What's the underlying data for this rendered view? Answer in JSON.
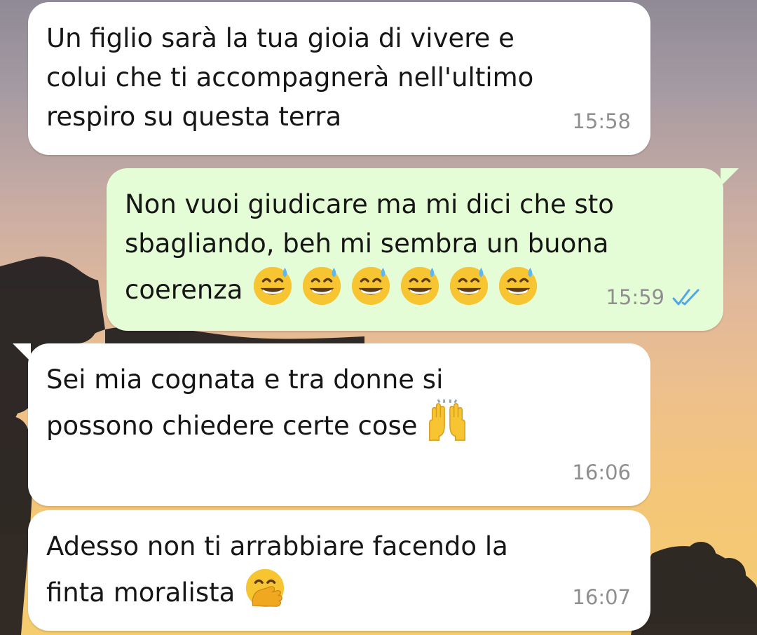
{
  "messages": [
    {
      "direction": "incoming",
      "text": "Un figlio sarà la tua gioia di vivere e\ncolui che ti accompagnerà nell'ultimo\nrespiro su questa terra",
      "time": "15:58"
    },
    {
      "direction": "outgoing",
      "text": "Non vuoi giudicare ma mi dici che sto\nsbagliando, beh mi sembra un buona\ncoerenza",
      "emoji": [
        "grinning-face-with-sweat-icon",
        "grinning-face-with-sweat-icon",
        "grinning-face-with-sweat-icon",
        "grinning-face-with-sweat-icon",
        "grinning-face-with-sweat-icon",
        "grinning-face-with-sweat-icon"
      ],
      "time": "15:59",
      "status": "read-double-check-icon"
    },
    {
      "direction": "incoming",
      "text": "Sei mia cognata e tra donne si\npossono chiedere certe cose",
      "emoji": [
        "raising-hands-icon"
      ],
      "time": "16:06"
    },
    {
      "direction": "incoming",
      "text": "Adesso non ti arrabbiare facendo la\nfinta moralista",
      "emoji": [
        "face-with-hand-over-mouth-icon"
      ],
      "time": "16:07"
    }
  ],
  "colors": {
    "incoming_bubble": "#ffffff",
    "outgoing_bubble": "#e4fdd6",
    "timestamp": "#8f8f8f",
    "read_ticks": "#4fa6e8"
  }
}
